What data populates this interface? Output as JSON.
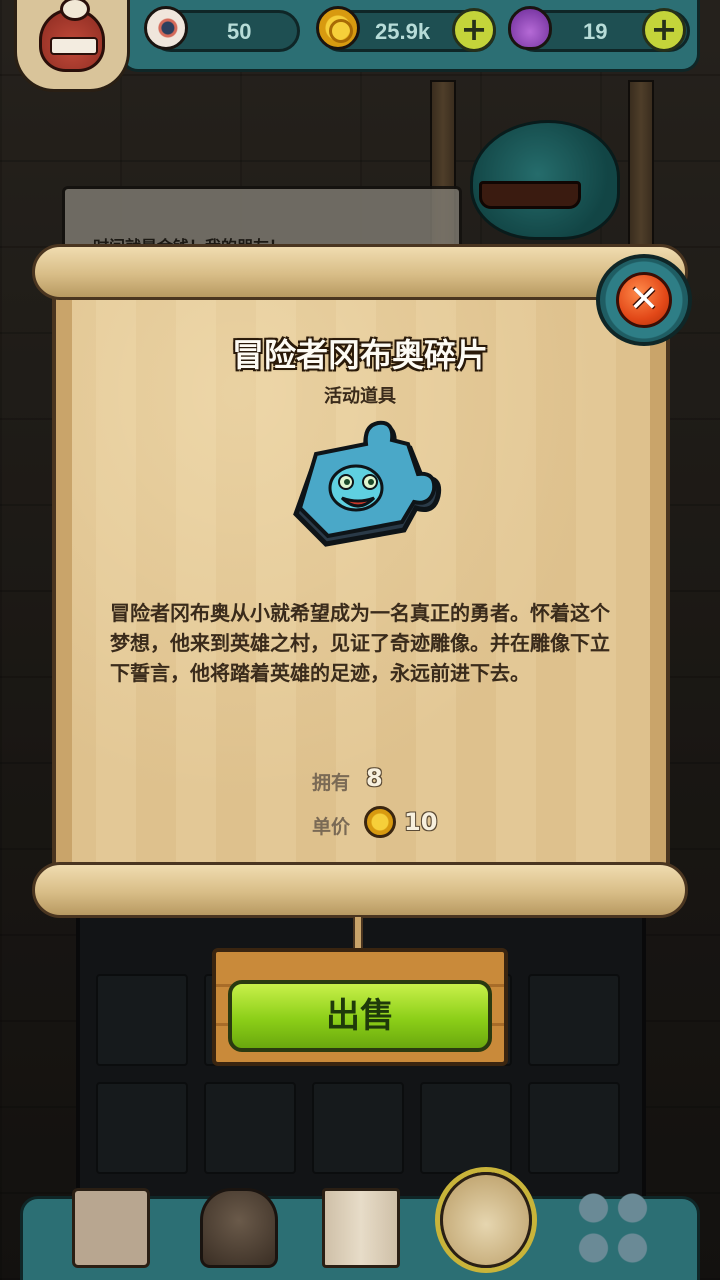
{
  "background": {
    "speech_text": "时间就是金钱！我的朋友！"
  },
  "resources": {
    "eyes": {
      "value": "50",
      "icon": "eyeball-icon"
    },
    "gold": {
      "value": "25.9k",
      "icon": "gold-coin-icon"
    },
    "potion": {
      "value": "19",
      "icon": "potion-icon"
    }
  },
  "dialog": {
    "title": "冒险者冈布奥碎片",
    "subtitle": "活动道具",
    "description": "冒险者冈布奥从小就希望成为一名真正的勇者。怀着这个梦想，他来到英雄之村，见证了奇迹雕像。并在雕像下立下誓言，他将踏着英雄的足迹，永远前进下去。",
    "owned_label": "拥有",
    "owned_value": "8",
    "price_label": "单价",
    "price_value": "10",
    "sell_label": "出售",
    "close_label": "✕"
  },
  "bottom_nav": [
    "shop-icon",
    "hero-icon",
    "book-icon",
    "bag-icon",
    "grid-icon"
  ],
  "colors": {
    "accent": "#8ccf18",
    "panel": "#2c6f74",
    "paper": "#e3c896"
  }
}
